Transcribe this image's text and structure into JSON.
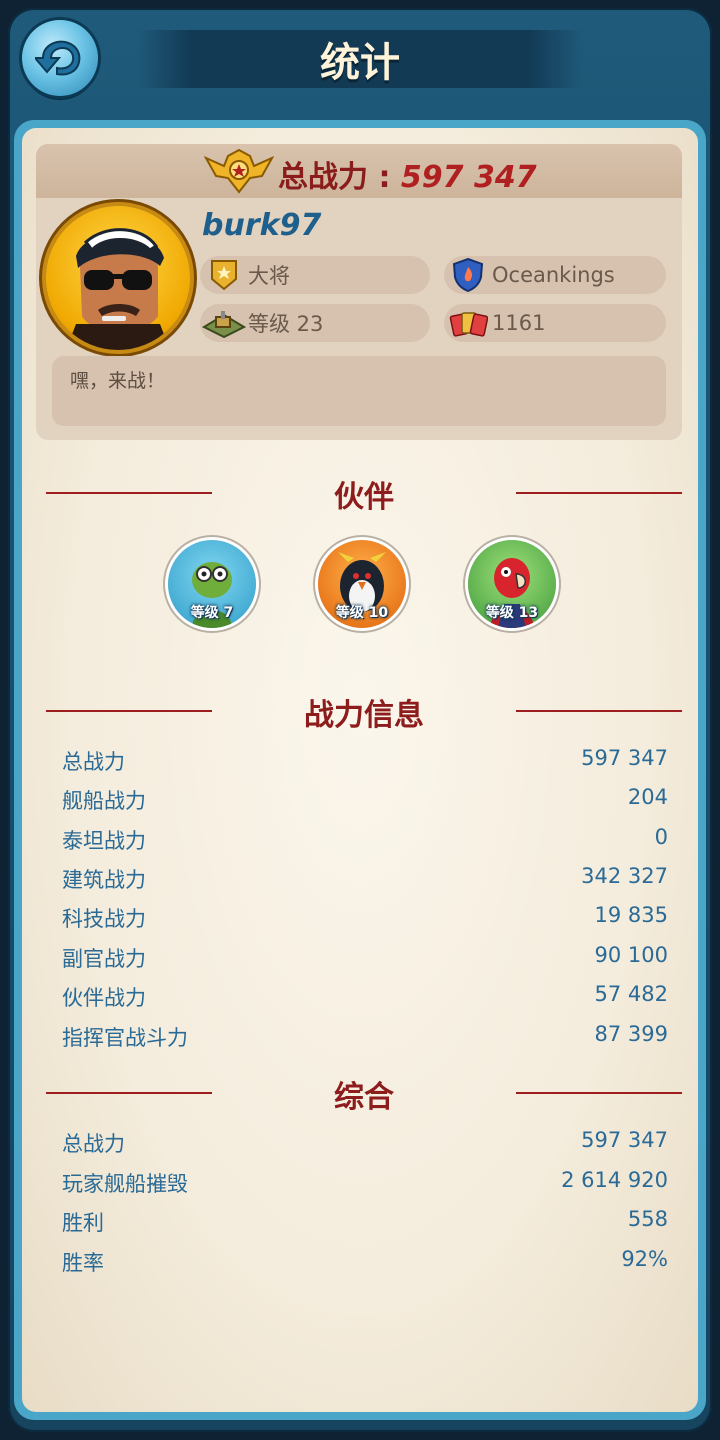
{
  "header": {
    "title": "统计"
  },
  "profile": {
    "total_power_label": "总战力 :",
    "total_power_value": "597 347",
    "username": "burk97",
    "rank": "大将",
    "alliance": "Oceankings",
    "level_text": "等级 23",
    "cards": "1161",
    "motto": "嘿，来战！"
  },
  "partners": {
    "title": "伙伴",
    "items": [
      {
        "icon": "turtle-partner",
        "level": "等级 7"
      },
      {
        "icon": "penguin-partner",
        "level": "等级 10"
      },
      {
        "icon": "parrot-partner",
        "level": "等级 13"
      }
    ]
  },
  "power_info": {
    "title": "战力信息",
    "rows": [
      {
        "label": "总战力",
        "value": "597 347"
      },
      {
        "label": "舰船战力",
        "value": "204"
      },
      {
        "label": "泰坦战力",
        "value": "0"
      },
      {
        "label": "建筑战力",
        "value": "342 327"
      },
      {
        "label": "科技战力",
        "value": "19 835"
      },
      {
        "label": "副官战力",
        "value": "90 100"
      },
      {
        "label": "伙伴战力",
        "value": "57 482"
      },
      {
        "label": "指挥官战斗力",
        "value": "87 399"
      }
    ]
  },
  "summary": {
    "title": "综合",
    "rows": [
      {
        "label": "总战力",
        "value": "597 347"
      },
      {
        "label": "玩家舰船摧毁",
        "value": "2 614 920"
      },
      {
        "label": "胜利",
        "value": "558"
      },
      {
        "label": "胜率",
        "value": "92%"
      }
    ]
  },
  "colors": {
    "accent_red": "#8d1c1c",
    "stat_blue": "#2a6a96",
    "frame_blue": "#1f5a7a"
  }
}
